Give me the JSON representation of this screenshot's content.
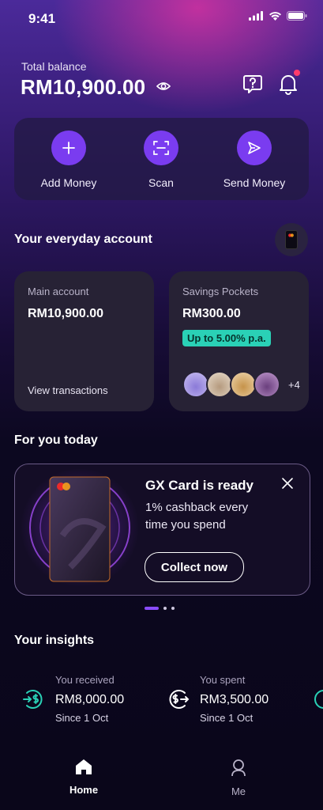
{
  "status": {
    "time": "9:41"
  },
  "balance": {
    "label": "Total balance",
    "amount": "RM10,900.00"
  },
  "actions": [
    {
      "label": "Add Money",
      "icon": "plus-icon"
    },
    {
      "label": "Scan",
      "icon": "scan-icon"
    },
    {
      "label": "Send Money",
      "icon": "send-icon"
    }
  ],
  "everyday": {
    "title": "Your everyday account",
    "main": {
      "title": "Main account",
      "amount": "RM10,900.00",
      "link": "View transactions"
    },
    "savings": {
      "title": "Savings Pockets",
      "amount": "RM300.00",
      "badge": "Up to 5.00% p.a.",
      "more": "+4"
    }
  },
  "for_you": {
    "title": "For you today",
    "promo": {
      "title": "GX Card is ready",
      "subtitle": "1% cashback every time you spend",
      "button": "Collect now"
    }
  },
  "insights": {
    "title": "Your insights",
    "items": [
      {
        "label": "You received",
        "amount": "RM8,000.00",
        "since": "Since 1 Oct"
      },
      {
        "label": "You spent",
        "amount": "RM3,500.00",
        "since": "Since 1 Oct"
      }
    ]
  },
  "nav": {
    "home": "Home",
    "me": "Me"
  },
  "colors": {
    "accent": "#7a3cf0",
    "badge": "#2ad1b6",
    "notification": "#ff3b6b"
  }
}
